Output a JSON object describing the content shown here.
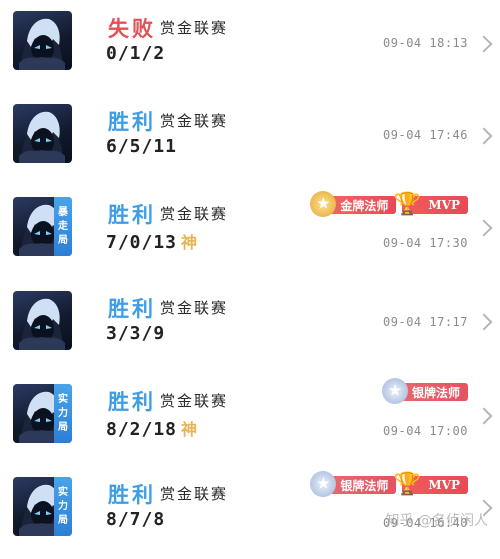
{
  "matches": [
    {
      "result": "失败",
      "mode": "赏金联赛",
      "kda": "0/1/2",
      "time": "09-04 18:13",
      "tag": null,
      "god": null,
      "badges": []
    },
    {
      "result": "胜利",
      "mode": "赏金联赛",
      "kda": "6/5/11",
      "time": "09-04 17:46",
      "tag": null,
      "god": null,
      "badges": []
    },
    {
      "result": "胜利",
      "mode": "赏金联赛",
      "kda": "7/0/13",
      "time": "09-04 17:30",
      "tag": [
        "暴",
        "走",
        "局"
      ],
      "god": "神",
      "badges": [
        {
          "kind": "gold",
          "label": "金牌法师",
          "icon": "star-icon"
        },
        {
          "kind": "mvp",
          "label": "MVP",
          "icon": "trophy-icon"
        }
      ]
    },
    {
      "result": "胜利",
      "mode": "赏金联赛",
      "kda": "3/3/9",
      "time": "09-04 17:17",
      "tag": null,
      "god": null,
      "badges": []
    },
    {
      "result": "胜利",
      "mode": "赏金联赛",
      "kda": "8/2/18",
      "time": "09-04 17:00",
      "tag": [
        "实",
        "力",
        "局"
      ],
      "god": "神",
      "badges": [
        {
          "kind": "silver",
          "label": "银牌法师",
          "icon": "star-icon"
        }
      ]
    },
    {
      "result": "胜利",
      "mode": "赏金联赛",
      "kda": "8/7/8",
      "time": "09-04 16:40",
      "tag": [
        "实",
        "力",
        "局"
      ],
      "god": null,
      "badges": [
        {
          "kind": "silver",
          "label": "银牌法师",
          "icon": "star-icon"
        },
        {
          "kind": "mvp",
          "label": "MVP",
          "icon": "trophy-icon"
        }
      ]
    }
  ],
  "watermark": "知乎 @名侦闲人",
  "colors": {
    "lose": "#e05257",
    "win": "#3f9de6",
    "god": "#e5b454",
    "time": "#8b8b8b"
  }
}
